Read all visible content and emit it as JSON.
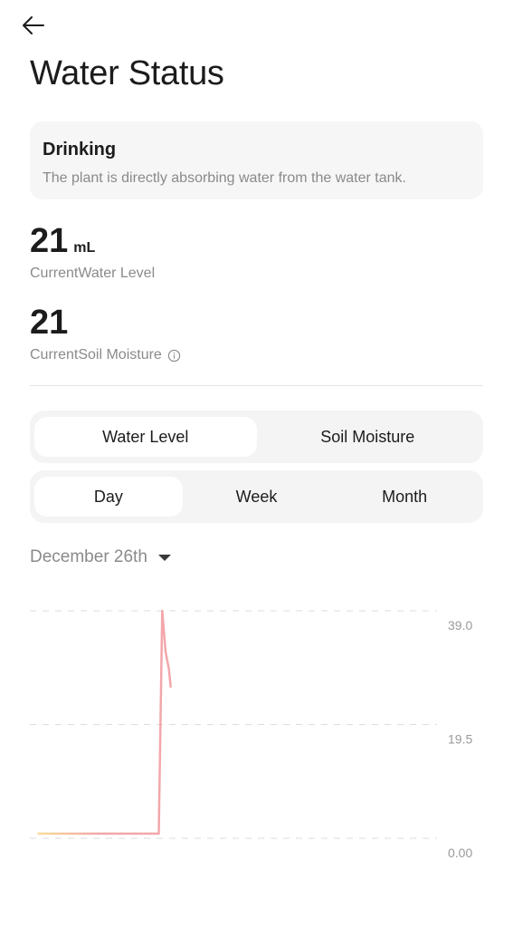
{
  "header": {
    "back_icon": "arrow-left-icon",
    "title": "Water Status"
  },
  "status": {
    "title": "Drinking",
    "description": "The plant is directly absorbing water from the water tank."
  },
  "water_level": {
    "value": "21",
    "unit": "mL",
    "label": "CurrentWater Level"
  },
  "soil_moisture": {
    "value": "21",
    "label": "CurrentSoil Moisture",
    "info_icon": "info-circle-icon"
  },
  "metric_tabs": [
    {
      "label": "Water Level",
      "active": true
    },
    {
      "label": "Soil Moisture",
      "active": false
    }
  ],
  "period_tabs": [
    {
      "label": "Day",
      "active": true
    },
    {
      "label": "Week",
      "active": false
    },
    {
      "label": "Month",
      "active": false
    }
  ],
  "date_picker": {
    "label": "December 26th",
    "icon": "caret-down-icon"
  },
  "colors": {
    "line_start": "#f5d27a",
    "line_main": "#ef8a8f",
    "grid": "#dddddd",
    "label": "#9a9a9a"
  },
  "chart_data": {
    "type": "line",
    "title": "",
    "xlabel": "",
    "ylabel": "",
    "ylim": [
      0,
      39
    ],
    "y_ticks": [
      "39.0",
      "19.5",
      "0.00"
    ],
    "grid": true,
    "x": [
      0.5,
      1,
      2,
      3,
      4,
      5,
      6,
      7,
      7.6,
      7.8,
      8.0,
      8.2,
      8.3
    ],
    "series": [
      {
        "values": [
          0.8,
          0.8,
          0.8,
          0.8,
          0.8,
          0.8,
          0.8,
          0.8,
          0.8,
          39.0,
          32.0,
          29.0,
          26.0
        ]
      }
    ]
  }
}
